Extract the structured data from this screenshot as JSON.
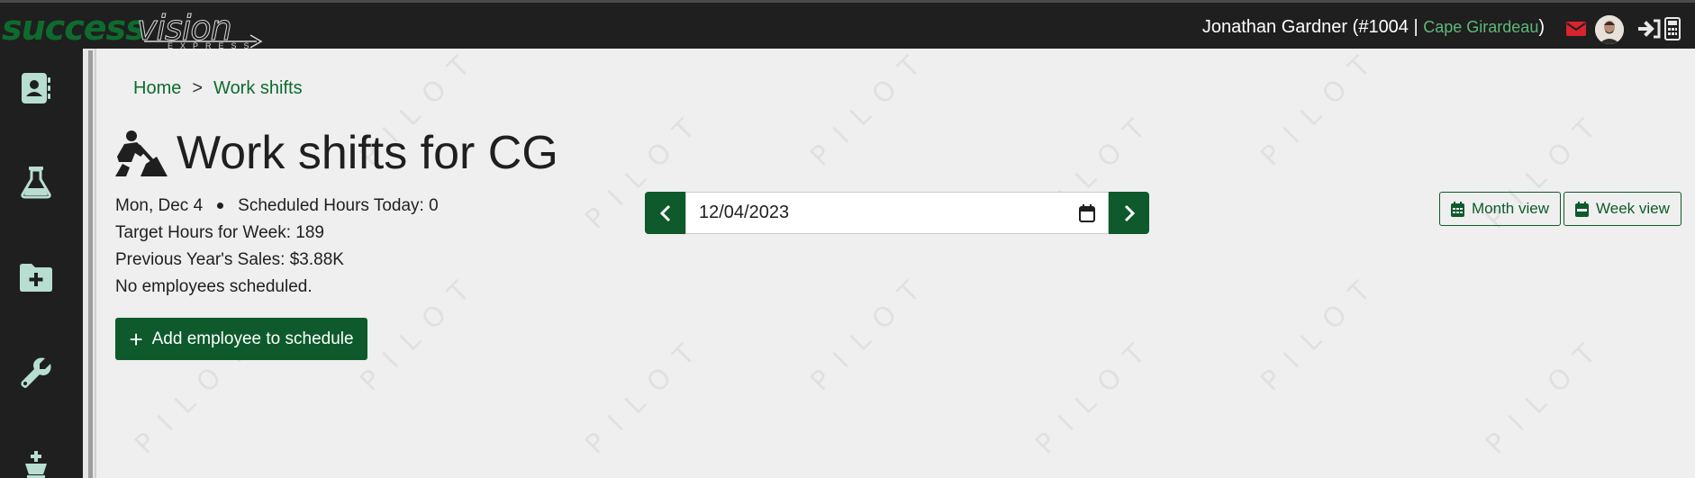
{
  "header": {
    "logo_success": "success",
    "logo_vision": "vision",
    "logo_express": "EXPRESS",
    "user_name": "Jonathan Gardner",
    "user_id": "(#1004 |",
    "store": "Cape Girardeau",
    "close_paren": ")"
  },
  "sidebar": {
    "items": [
      {
        "icon": "contact-book-icon"
      },
      {
        "icon": "flask-icon"
      },
      {
        "icon": "folder-plus-icon"
      },
      {
        "icon": "wrench-icon"
      },
      {
        "icon": "chess-king-icon"
      }
    ]
  },
  "watermark": "PILOT",
  "breadcrumb": {
    "home": "Home",
    "separator": ">",
    "current": "Work shifts"
  },
  "page": {
    "title": "Work shifts for CG",
    "date_label": "Mon, Dec 4",
    "scheduled_hours": "Scheduled Hours Today: 0",
    "target_hours": "Target Hours for Week: 189",
    "prev_sales": "Previous Year's Sales: $3.88K",
    "no_employees": "No employees scheduled.",
    "add_button": "Add employee to schedule"
  },
  "date_picker": {
    "value": "12/04/2023"
  },
  "views": {
    "month": "Month view",
    "week": "Week view"
  },
  "colors": {
    "brand_green": "#0e5a2c",
    "link_green": "#0e6b2e",
    "topbar": "#1f1f1f",
    "mail_red": "#d9232d"
  }
}
